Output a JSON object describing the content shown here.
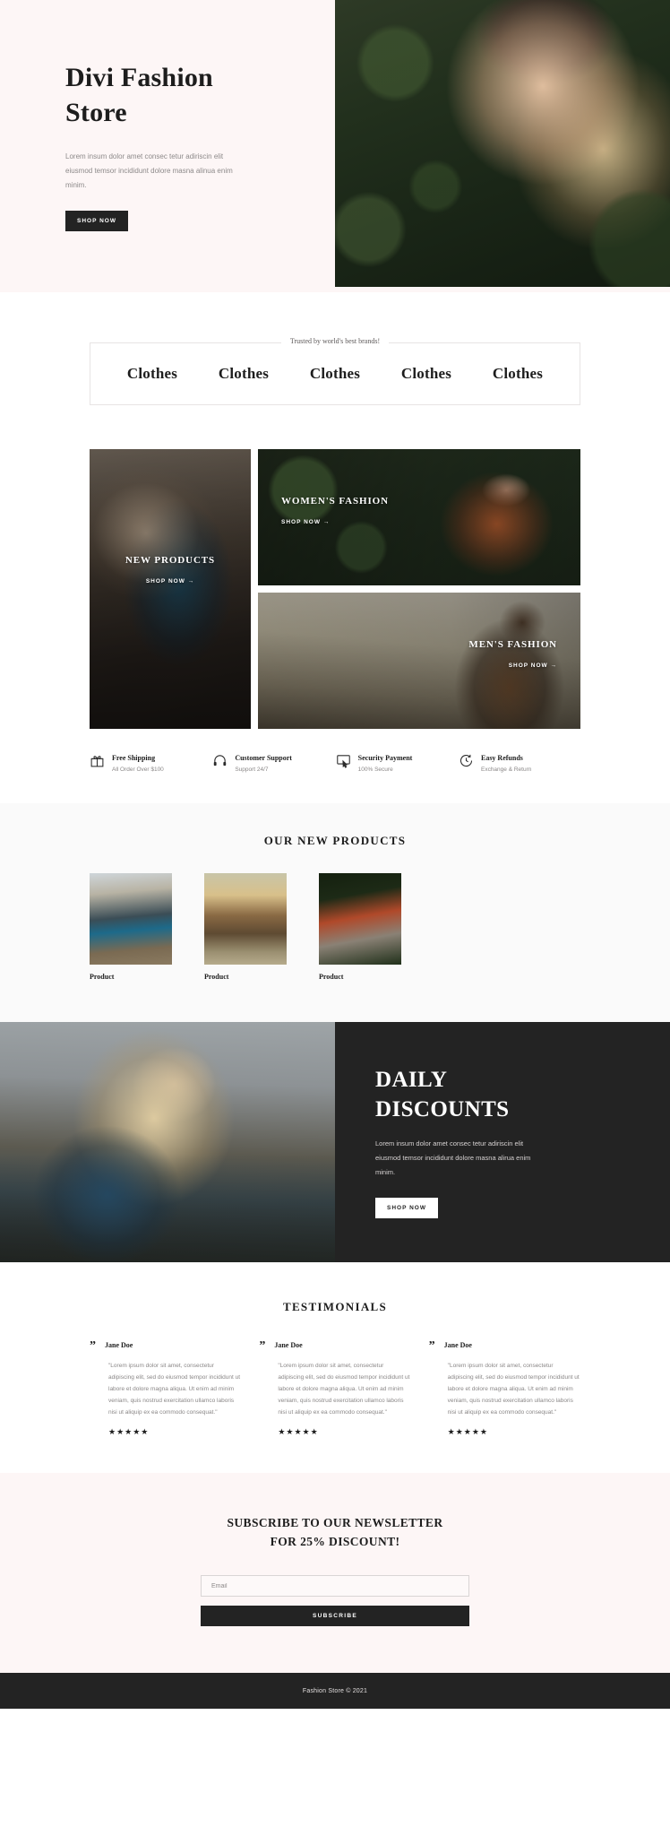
{
  "hero": {
    "title": "Divi Fashion Store",
    "paragraph": "Lorem insum dolor amet consec tetur adiriscin elit eiusmod temsor incididunt dolore masna alinua enim minim.",
    "cta": "SHOP NOW"
  },
  "brands": {
    "label": "Trusted by world's best brands!",
    "items": [
      "Clothes",
      "Clothes",
      "Clothes",
      "Clothes",
      "Clothes"
    ]
  },
  "categories": [
    {
      "title": "NEW PRODUCTS",
      "cta": "SHOP NOW →"
    },
    {
      "title": "WOMEN'S FASHION",
      "cta": "SHOP NOW →"
    },
    {
      "title": "MEN'S FASHION",
      "cta": "SHOP NOW →"
    }
  ],
  "benefits": [
    {
      "icon": "gift-icon",
      "title": "Free Shipping",
      "sub": "All Order Over $100"
    },
    {
      "icon": "headphones-icon",
      "title": "Customer Support",
      "sub": "Support 24/7"
    },
    {
      "icon": "secure-payment-icon",
      "title": "Security Payment",
      "sub": "100% Secure"
    },
    {
      "icon": "clock-refund-icon",
      "title": "Easy Refunds",
      "sub": "Exchange & Return"
    }
  ],
  "products": {
    "heading": "OUR NEW PRODUCTS",
    "items": [
      {
        "name": "Product"
      },
      {
        "name": "Product"
      },
      {
        "name": "Product"
      }
    ]
  },
  "discount": {
    "title_line1": "DAILY",
    "title_line2": "DISCOUNTS",
    "paragraph": "Lorem insum dolor amet consec tetur adiriscin elit eiusmod temsor incididunt dolore masna alirua enim minim.",
    "cta": "SHOP NOW"
  },
  "testimonials": {
    "heading": "TESTIMONIALS",
    "items": [
      {
        "quote_mark": "”",
        "name": "Jane Doe",
        "text": "\"Lorem ipsum dolor sit amet, consectetur adipiscing elit, sed do eiusmod tempor incididunt ut labore et dolore magna aliqua. Ut enim ad minim veniam, quis nostrud exercitation ullamco laboris nisi ut aliquip ex ea commodo consequat.\"",
        "rating": "★★★★★"
      },
      {
        "quote_mark": "”",
        "name": "Jane Doe",
        "text": "\"Lorem ipsum dolor sit amet, consectetur adipiscing elit, sed do eiusmod tempor incididunt ut labore et dolore magna aliqua. Ut enim ad minim veniam, quis nostrud exercitation ullamco laboris nisi ut aliquip ex ea commodo consequat.\"",
        "rating": "★★★★★"
      },
      {
        "quote_mark": "”",
        "name": "Jane Doe",
        "text": "\"Lorem ipsum dolor sit amet, consectetur adipiscing elit, sed do eiusmod tempor incididunt ut labore et dolore magna aliqua. Ut enim ad minim veniam, quis nostrud exercitation ullamco laboris nisi ut aliquip ex ea commodo consequat.\"",
        "rating": "★★★★★"
      }
    ]
  },
  "newsletter": {
    "title_line1": "SUBSCRIBE TO OUR NEWSLETTER",
    "title_line2": "FOR 25% DISCOUNT!",
    "email_placeholder": "Email",
    "email_value": "",
    "cta": "SUBSCRIBE"
  },
  "footer": {
    "copyright": "Fashion Store © 2021"
  },
  "colors": {
    "hero_bg": "#fdf6f6",
    "dark": "#232323",
    "page_bg": "#ffffff",
    "muted_section": "#fafafa",
    "text_muted": "#8a8787"
  }
}
